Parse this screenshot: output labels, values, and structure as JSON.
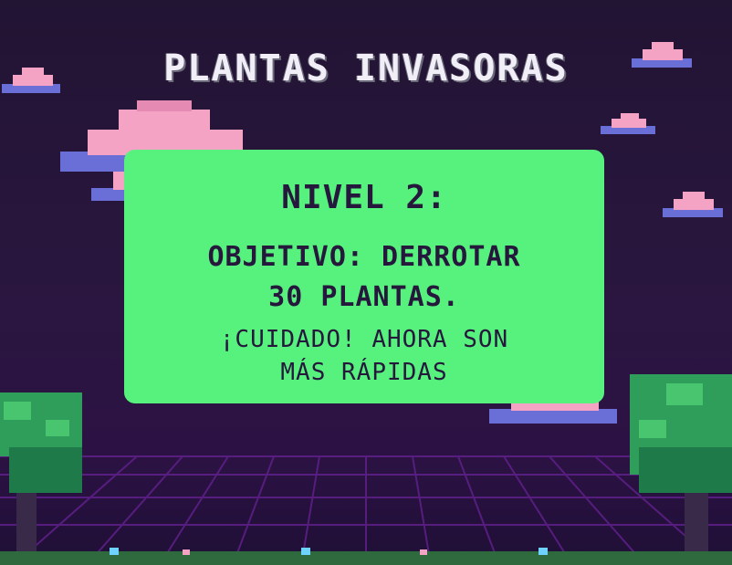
{
  "screen": {
    "title": "PLANTAS INVASORAS",
    "level_label": "NIVEL 2:",
    "objective_line1": "OBJETIVO: DERROTAR",
    "objective_line2": "30 PLANTAS.",
    "warning_line1": "¡CUIDADO! AHORA SON",
    "warning_line2": "MÁS RÁPIDAS"
  },
  "colors": {
    "background": "#221433",
    "panel": "#57f27d",
    "panel_text": "#26173d",
    "grid": "#5c1f86",
    "cloud_pink": "#f4a3c4",
    "cloud_blue": "#6a6fd8",
    "tree_green": "#2f9e5a"
  },
  "decor": {
    "clouds": [
      "cloud-icon",
      "cloud-icon",
      "cloud-icon",
      "cloud-icon",
      "cloud-icon",
      "cloud-icon",
      "cloud-icon"
    ],
    "trees": [
      "pixel-tree-icon",
      "pixel-tree-icon"
    ]
  }
}
